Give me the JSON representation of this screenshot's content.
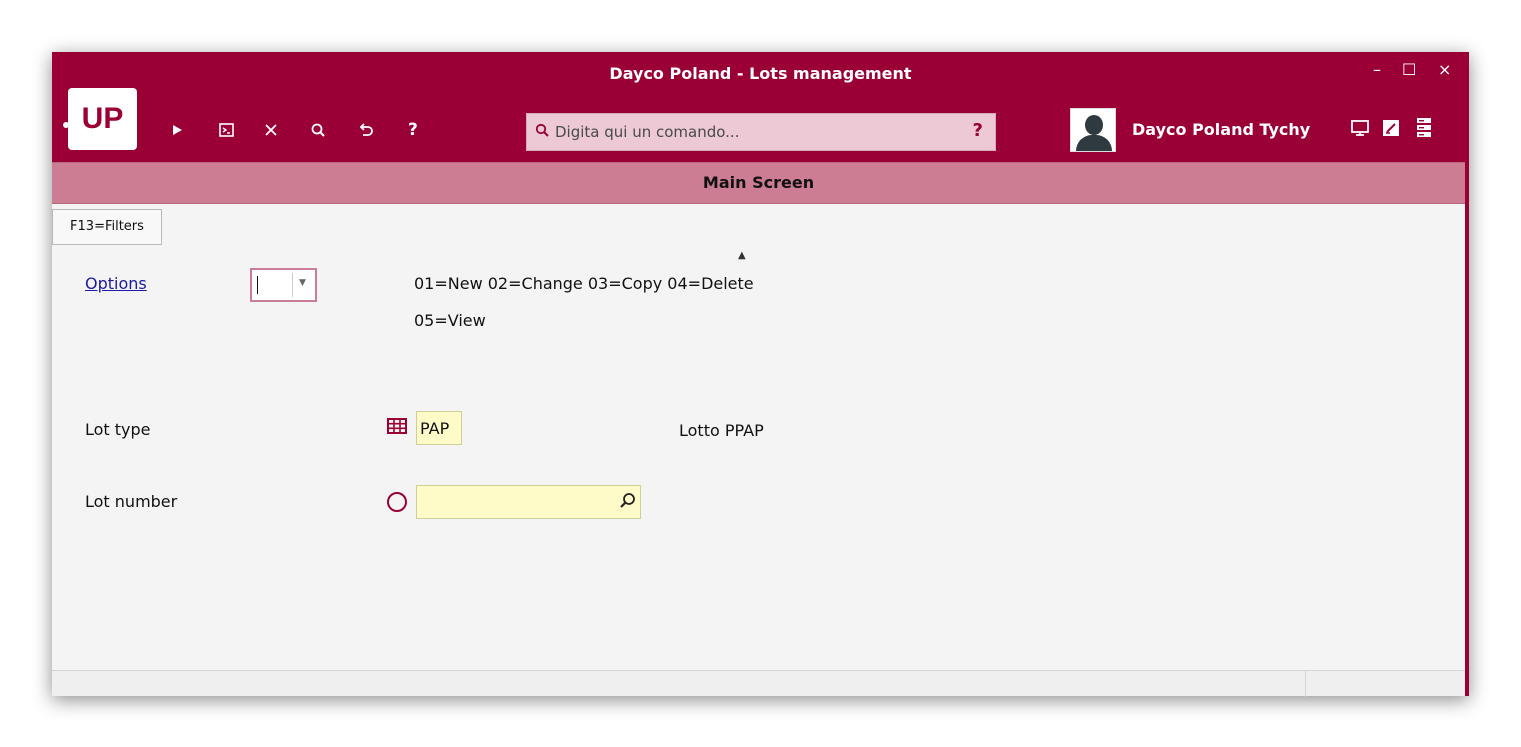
{
  "window": {
    "title": "Dayco Poland - Lots management",
    "controls": {
      "minimize": "–",
      "maximize": "☐",
      "close": "×"
    }
  },
  "toolbar": {
    "logo": "UP",
    "icons": [
      "play-icon",
      "terminal-icon",
      "close-icon",
      "search-icon",
      "undo-icon",
      "help-icon"
    ]
  },
  "command_bar": {
    "placeholder": "Digita qui un comando...",
    "help": "?"
  },
  "user": {
    "name": "Dayco Poland Tychy"
  },
  "header_right_icons": [
    "monitor-icon",
    "edit-icon",
    "server-icon"
  ],
  "screen": {
    "title": "Main Screen"
  },
  "filters_button": "F13=Filters",
  "options": {
    "label": "Options",
    "value": "",
    "legend_line1": "01=New 02=Change 03=Copy 04=Delete",
    "legend_line2": "05=View"
  },
  "fields": {
    "lot_type": {
      "label": "Lot type",
      "value": "PAP",
      "description": "Lotto PPAP"
    },
    "lot_number": {
      "label": "Lot number",
      "value": ""
    }
  },
  "colors": {
    "brand": "#9a0035",
    "subheader": "#cc7d93",
    "input_bg": "#fffbc8",
    "link": "#1a1aa6"
  }
}
